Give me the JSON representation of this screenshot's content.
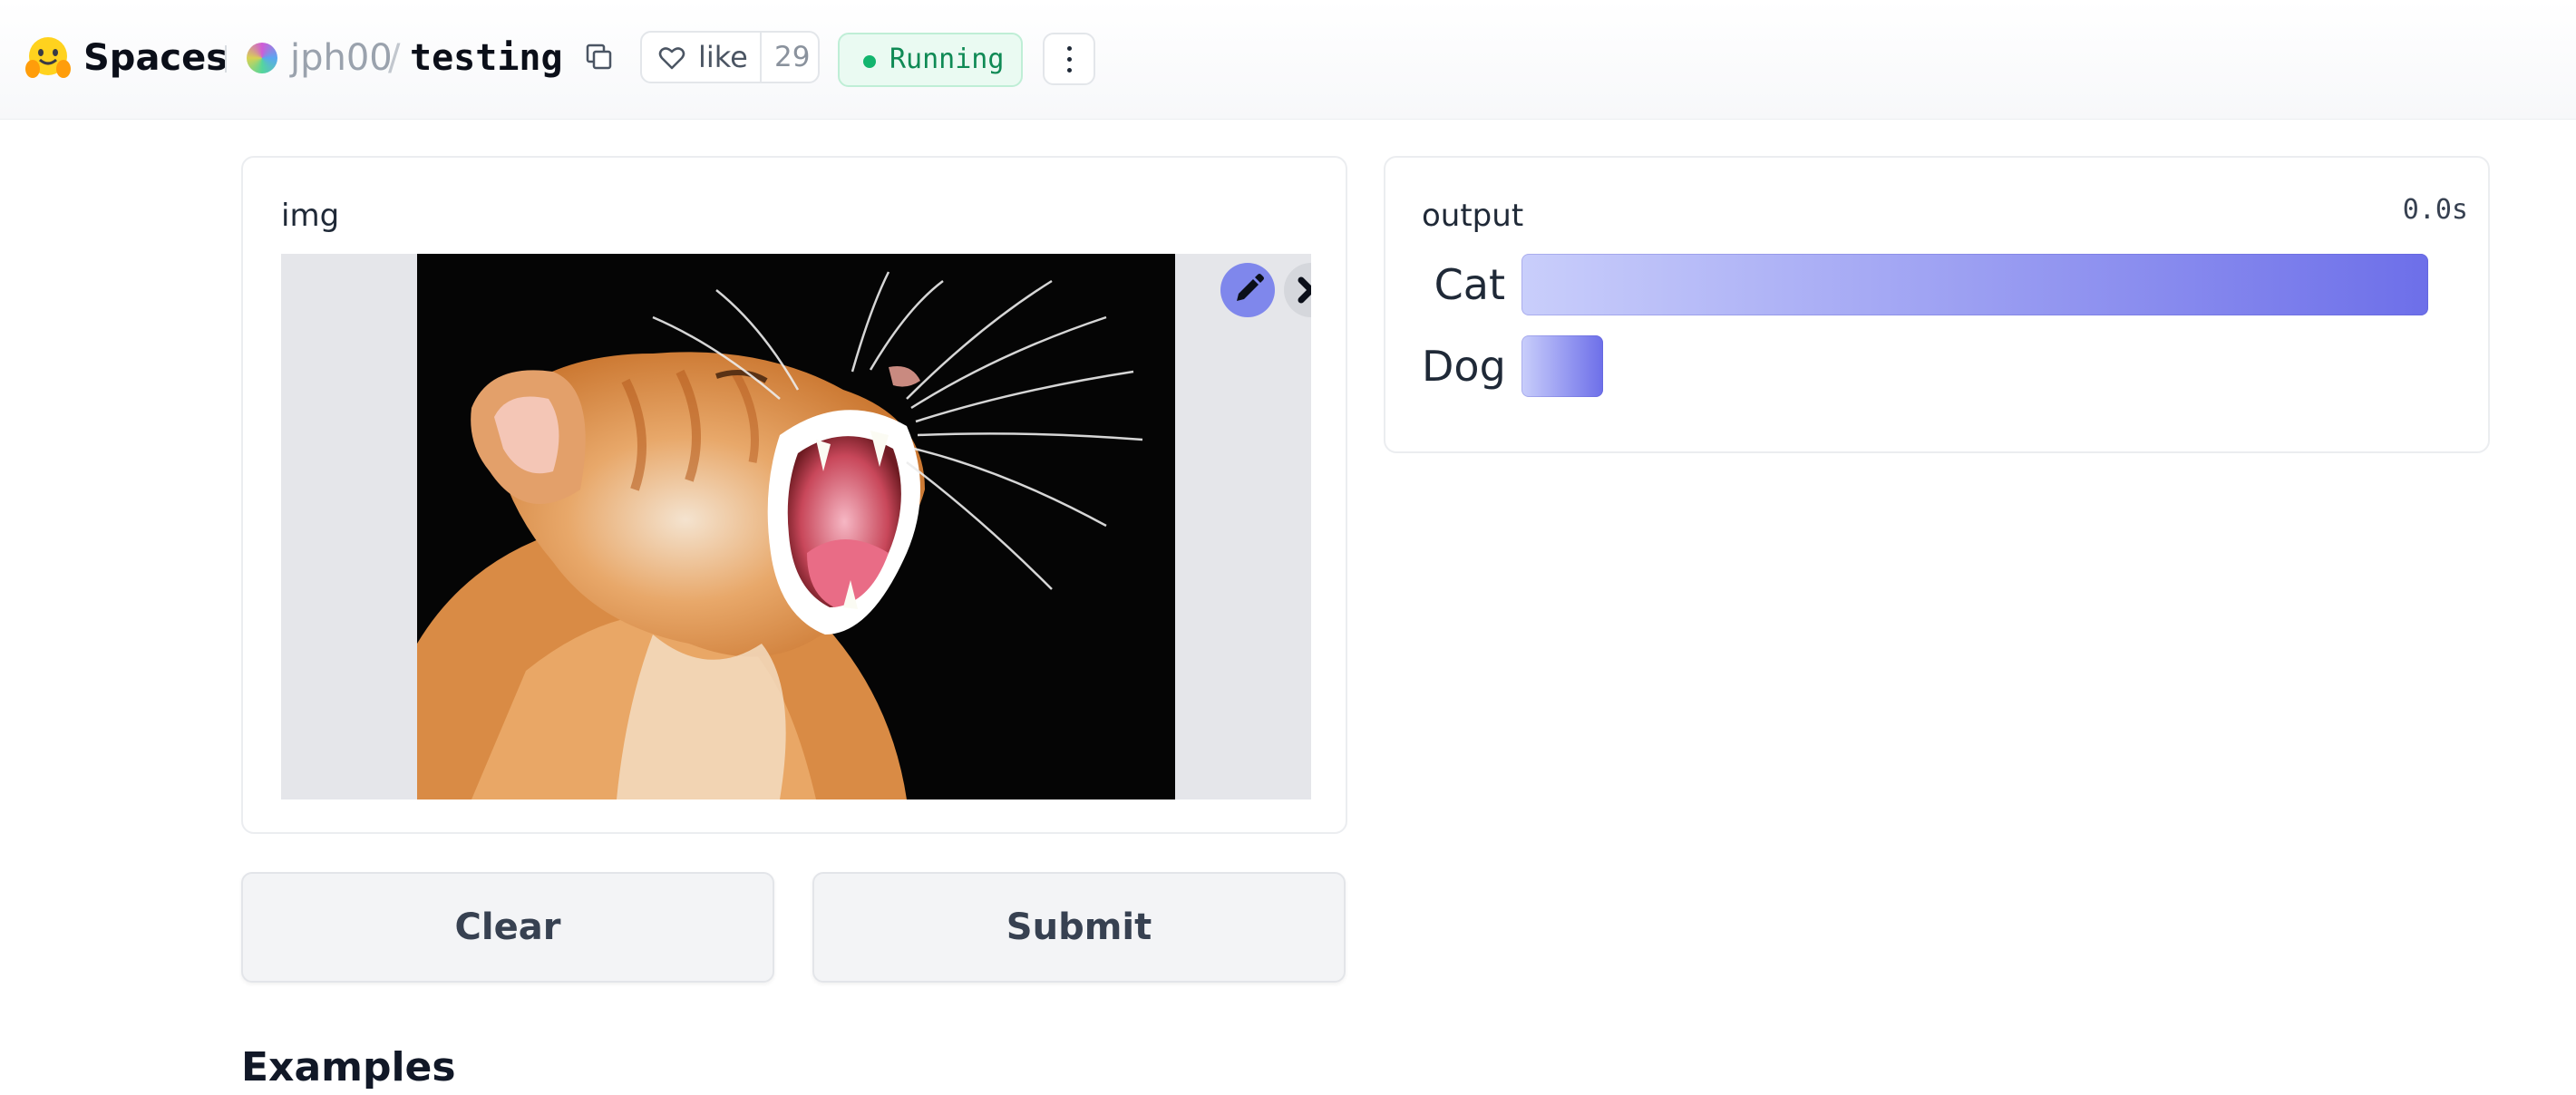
{
  "header": {
    "brand": "Spaces",
    "owner": "jph00",
    "separator": "/",
    "repo": "testing",
    "like_label": "like",
    "like_count": "29",
    "status": "Running"
  },
  "input": {
    "label": "img"
  },
  "output": {
    "label": "output",
    "timer": "0.0s",
    "labels": [
      {
        "name": "Cat",
        "confidence": 1.0
      },
      {
        "name": "Dog",
        "confidence": 0.09
      }
    ]
  },
  "buttons": {
    "clear": "Clear",
    "submit": "Submit"
  },
  "examples": {
    "heading": "Examples"
  },
  "colors": {
    "accent": "#6d6fe9",
    "status_green": "#12b56e",
    "bar_start": "#c9cefb"
  },
  "icons": [
    "hugging-face-logo-icon",
    "copy-icon",
    "heart-icon",
    "more-options-icon",
    "pencil-icon",
    "close-icon"
  ]
}
